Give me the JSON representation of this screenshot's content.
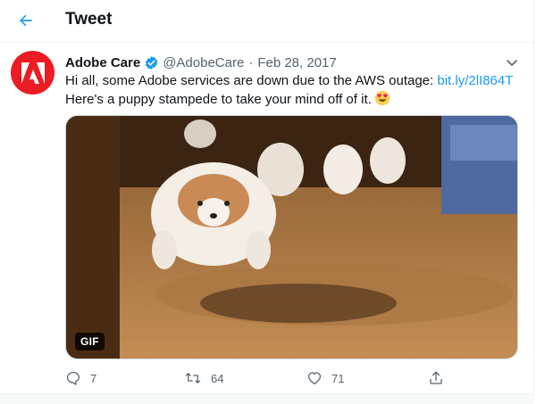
{
  "header": {
    "title": "Tweet"
  },
  "tweet": {
    "author_name": "Adobe Care",
    "handle": "@AdobeCare",
    "separator": "·",
    "date": "Feb 28, 2017",
    "text_line1": "Hi all, some Adobe services are down due to the AWS outage: ",
    "link": "bit.ly/2lI864T",
    "text_line2": "Here's a puppy stampede to take your mind off of it.",
    "emoji": "heart-eyes-emoji",
    "media_badge": "GIF"
  },
  "actions": {
    "replies": "7",
    "retweets": "64",
    "likes": "71"
  },
  "colors": {
    "accent": "#1d9bf0",
    "adobe_red": "#ec1c24",
    "secondary_text": "#536471"
  },
  "icons": [
    "back-arrow-icon",
    "verified-badge-icon",
    "chevron-down-icon",
    "reply-icon",
    "retweet-icon",
    "like-icon",
    "share-icon"
  ]
}
